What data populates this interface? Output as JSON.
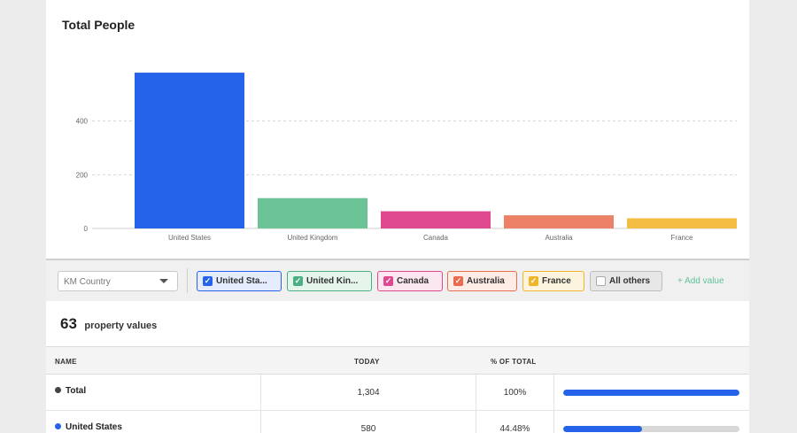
{
  "chart": {
    "title": "Total People"
  },
  "chart_data": {
    "type": "bar",
    "title": "Total People",
    "xlabel": "",
    "ylabel": "",
    "categories": [
      "United States",
      "United Kingdom",
      "Canada",
      "Australia",
      "France"
    ],
    "values": [
      580,
      113,
      64,
      49,
      38
    ],
    "colors": [
      "#2563eb",
      "#6cc396",
      "#e0498f",
      "#ec8168",
      "#f4be45"
    ],
    "ylim": [
      0,
      600
    ],
    "yticks": [
      0,
      200,
      400
    ],
    "grid": true,
    "legend": "none"
  },
  "filter": {
    "select_value": "KM Country",
    "chips": [
      {
        "label": "United Sta...",
        "color": "#2563eb",
        "bg": "#e4ecfd",
        "checked": true
      },
      {
        "label": "United Kin...",
        "color": "#4caf84",
        "bg": "#e5f5ec",
        "checked": true
      },
      {
        "label": "Canada",
        "color": "#e0498f",
        "bg": "#fbe7f0",
        "checked": true
      },
      {
        "label": "Australia",
        "color": "#ec6a4f",
        "bg": "#fdebe6",
        "checked": true
      },
      {
        "label": "France",
        "color": "#f0b528",
        "bg": "#fdf4df",
        "checked": true
      },
      {
        "label": "All others",
        "color": "#bdbdbd",
        "bg": "#e7e7e7",
        "checked": false
      }
    ],
    "add_value_label": "+ Add value"
  },
  "summary": {
    "count": "63",
    "label": "property values"
  },
  "table": {
    "headers": {
      "name": "NAME",
      "today": "TODAY",
      "pct": "% OF TOTAL"
    },
    "rows": [
      {
        "name": "Total",
        "dot_color": "#444444",
        "today": "1,304",
        "pct": "100%",
        "fraction": 1.0
      },
      {
        "name": "United States",
        "dot_color": "#2563eb",
        "today": "580",
        "pct": "44.48%",
        "fraction": 0.4448
      }
    ]
  }
}
